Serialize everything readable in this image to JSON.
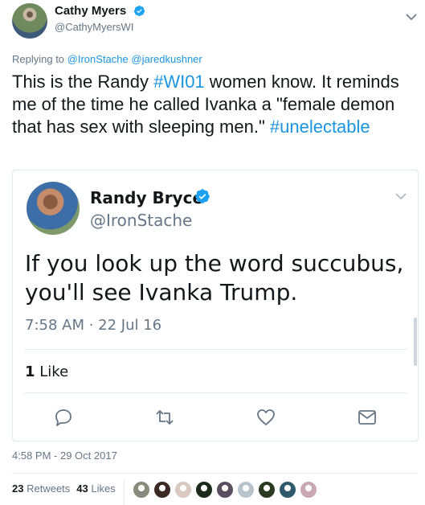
{
  "tweet": {
    "author_name": "Cathy Myers",
    "author_handle": "@CathyMyersWI",
    "replying_prefix": "Replying to",
    "replying_mentions": [
      "@IronStache",
      "@jaredkushner"
    ],
    "text_parts": [
      "This is the Randy ",
      "#WI01",
      " women know. It reminds me of the time he called Ivanka a \"female demon that has sex with sleeping men.\" ",
      "#unelectable"
    ],
    "timestamp": "4:58 PM - 29 Oct 2017",
    "retweets_count": "23",
    "retweets_label": "Retweets",
    "likes_count": "43",
    "likes_label": "Likes"
  },
  "embedded": {
    "name": "Randy Bryce",
    "handle": "@IronStache",
    "text": "If you look up the word succubus, you'll see Ivanka Trump.",
    "time": "7:58 AM · 22 Jul 16",
    "likes_count": "1",
    "likes_label": "Like",
    "actions": [
      "reply-icon",
      "retweet-icon",
      "like-icon",
      "message-icon"
    ]
  },
  "likers": [
    {
      "color": "#8a8a7a"
    },
    {
      "color": "#3a2a22"
    },
    {
      "color": "#d9c9c0"
    },
    {
      "color": "#1c2a1c"
    },
    {
      "color": "#5a4e60"
    },
    {
      "color": "#b8c4cc"
    },
    {
      "color": "#2a3a20"
    },
    {
      "color": "#2f5a6e"
    },
    {
      "color": "#c9a8b4"
    }
  ],
  "colors": {
    "link": "#1b95e0",
    "verified": "#1da1f2",
    "secondary_text": "#657786"
  }
}
